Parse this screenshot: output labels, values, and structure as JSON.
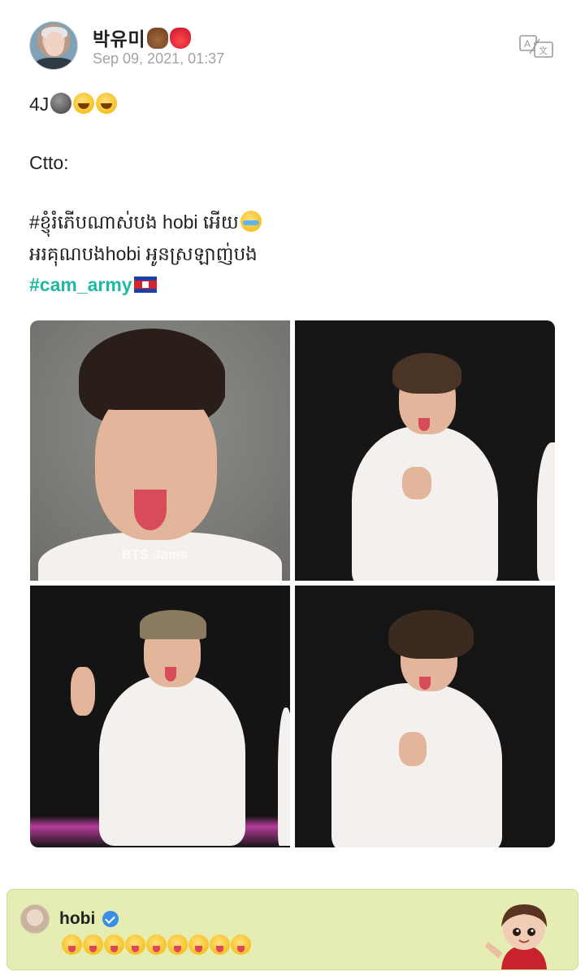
{
  "post": {
    "author": {
      "name": "박유미",
      "name_emojis": [
        "bear",
        "strawberry"
      ]
    },
    "timestamp": "Sep 09, 2021, 01:37",
    "translate_icon": "translate-icon",
    "lines": {
      "line1_text": "4J",
      "line1_emojis": [
        "new-moon-face",
        "rolling-laugh",
        "rolling-laugh"
      ],
      "line2_text": "Ctto:",
      "line3_text": "#ខ្ញុំរំភើបណាស់បង hobi អើយ",
      "line3_emoji": "loudly-crying-face",
      "line4_text": "អរគុណបងhobi អូនស្រឡាញ់បង",
      "hashtag": "#cam_army",
      "hashtag_flag": "cambodia-flag",
      "hashtag_color": "#1fb8a2"
    },
    "photos": [
      {
        "id": "photo-1",
        "watermark": "BTS Jams"
      },
      {
        "id": "photo-2"
      },
      {
        "id": "photo-3"
      },
      {
        "id": "photo-4"
      }
    ]
  },
  "comment": {
    "author": "hobi",
    "verified": true,
    "verified_color": "#3a8ee6",
    "emoji": "face-with-tongue-winking",
    "emoji_count": 9,
    "background": "#e6edb3",
    "sticker": "chibi-sticker"
  }
}
